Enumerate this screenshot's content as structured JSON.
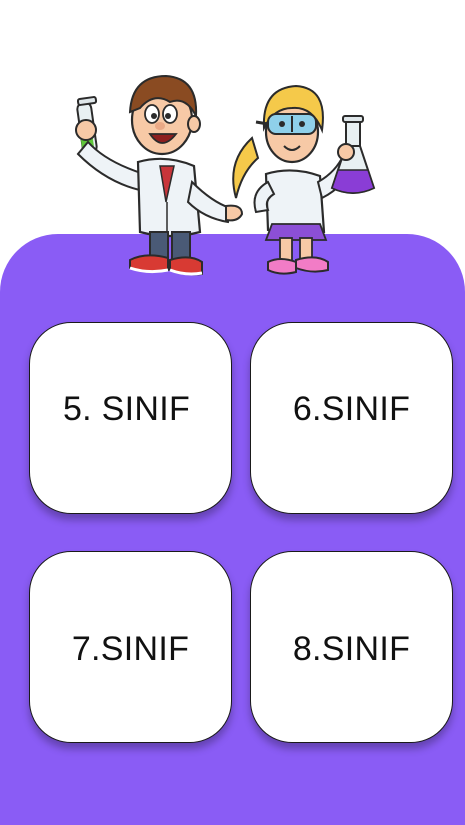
{
  "colors": {
    "panel_background": "#8a5cf5",
    "card_background": "#ffffff",
    "card_border": "#1a1a1a",
    "label_text": "#111111"
  },
  "header": {
    "illustration": "two-kid-scientists-with-flasks-icon"
  },
  "grades": [
    {
      "label": "5. SINIF"
    },
    {
      "label": "6.SINIF"
    },
    {
      "label": "7.SINIF"
    },
    {
      "label": "8.SINIF"
    }
  ]
}
